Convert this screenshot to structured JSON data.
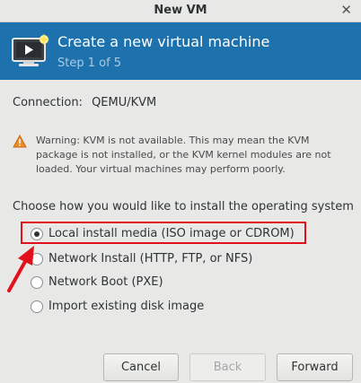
{
  "window": {
    "title": "New VM",
    "close_glyph": "✕"
  },
  "header": {
    "title": "Create a new virtual machine",
    "step": "Step 1 of 5",
    "icon": "monitor-play-icon"
  },
  "connection": {
    "label": "Connection:",
    "value": "QEMU/KVM"
  },
  "warning": {
    "icon": "warning-icon",
    "text": "Warning: KVM is not available. This may mean the KVM package is not installed, or the KVM kernel modules are not loaded. Your virtual machines may perform poorly."
  },
  "install": {
    "prompt": "Choose how you would like to install the operating system",
    "options": [
      {
        "label": "Local install media (ISO image or CDROM)",
        "selected": true
      },
      {
        "label": "Network Install (HTTP, FTP, or NFS)",
        "selected": false
      },
      {
        "label": "Network Boot (PXE)",
        "selected": false
      },
      {
        "label": "Import existing disk image",
        "selected": false
      }
    ]
  },
  "annotation": {
    "highlight_color": "#e2101a"
  },
  "buttons": {
    "cancel": "Cancel",
    "back": "Back",
    "forward": "Forward"
  },
  "colors": {
    "banner": "#1d72ae",
    "window_bg": "#e8e8e7"
  }
}
